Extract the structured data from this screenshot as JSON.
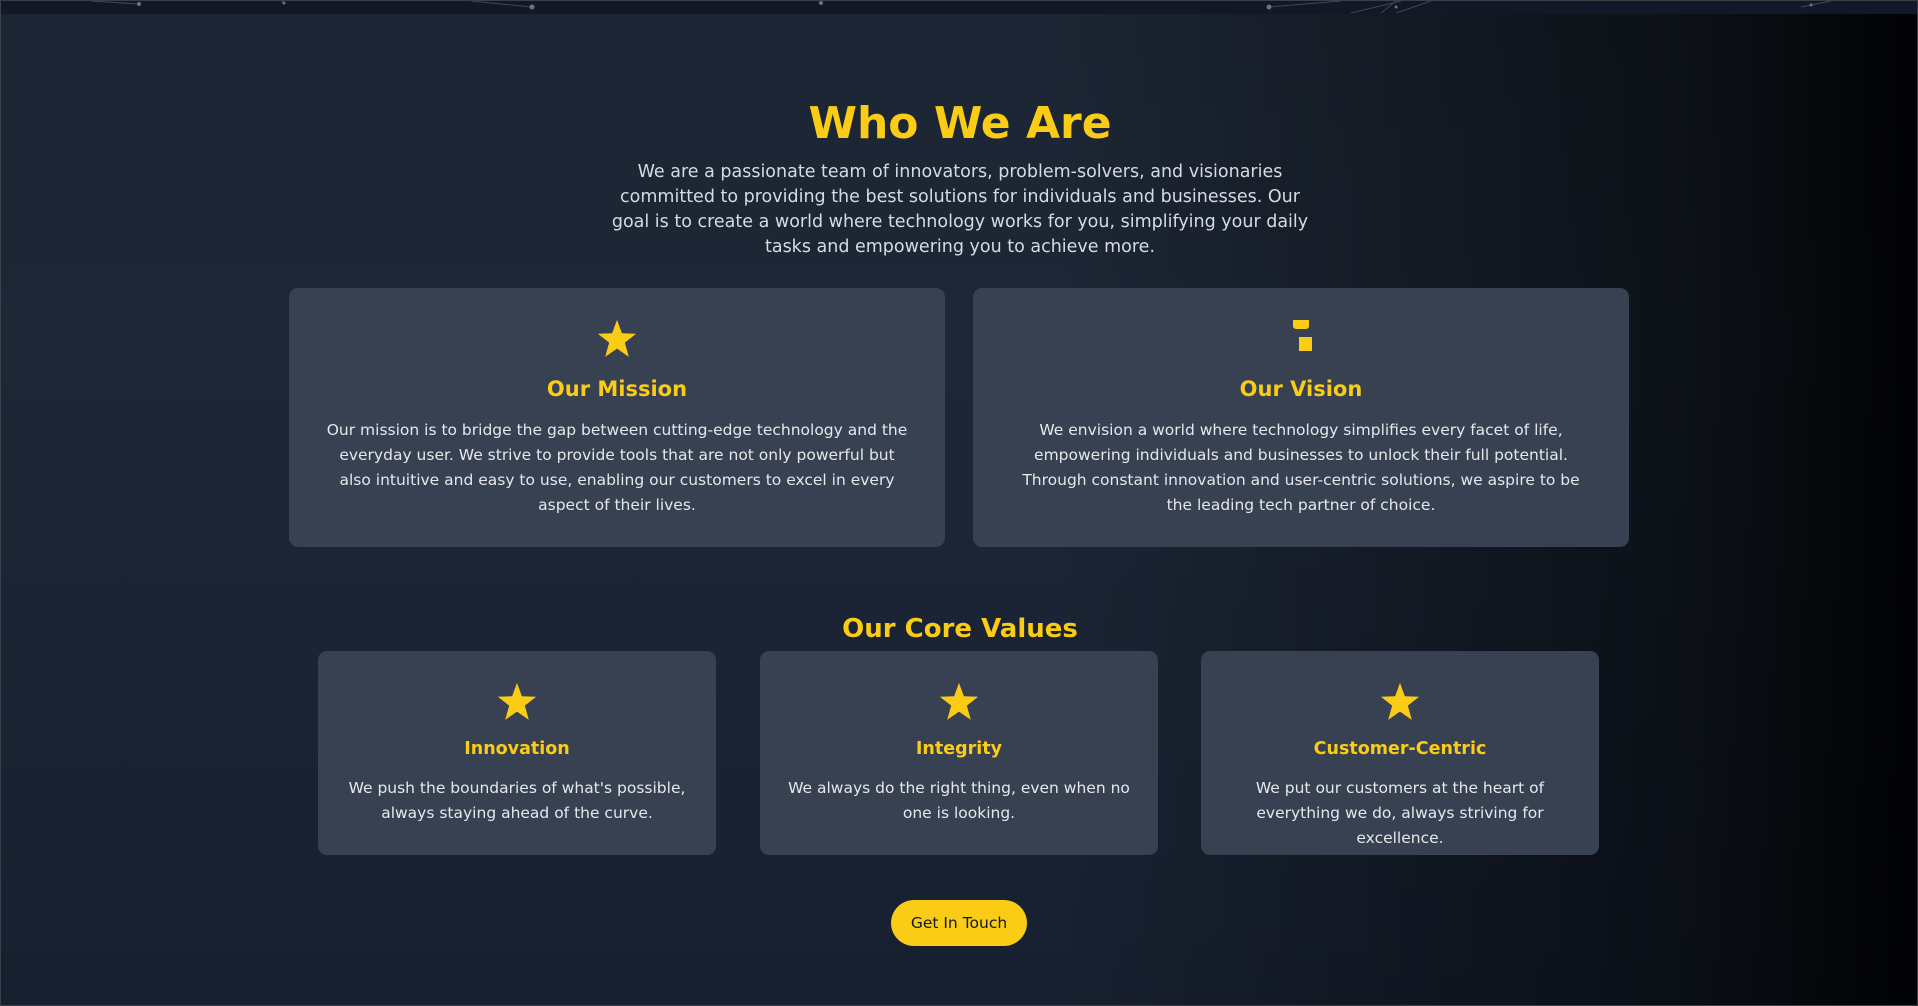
{
  "about": {
    "title": "Who We Are",
    "intro": "We are a passionate team of innovators, problem-solvers, and visionaries committed to providing the best solutions for individuals and businesses. Our goal is to create a world where technology works for you, simplifying your daily tasks and empowering you to achieve more."
  },
  "cards": [
    {
      "icon": "star-icon",
      "title": "Our Mission",
      "text": "Our mission is to bridge the gap between cutting-edge technology and the everyday user. We strive to provide tools that are not only powerful but also intuitive and easy to use, enabling our customers to excel in every aspect of their lives."
    },
    {
      "icon": "lightbulb-icon",
      "title": "Our Vision",
      "text": "We envision a world where technology simplifies every facet of life, empowering individuals and businesses to unlock their full potential. Through constant innovation and user-centric solutions, we aspire to be the leading tech partner of choice."
    }
  ],
  "values": {
    "heading": "Our Core Values",
    "items": [
      {
        "icon": "star-icon",
        "title": "Innovation",
        "text": "We push the boundaries of what's possible, always staying ahead of the curve."
      },
      {
        "icon": "star-icon",
        "title": "Integrity",
        "text": "We always do the right thing, even when no one is looking."
      },
      {
        "icon": "star-icon",
        "title": "Customer-Centric",
        "text": "We put our customers at the heart of everything we do, always striving for excellence."
      }
    ]
  },
  "cta": {
    "label": "Get In Touch"
  },
  "colors": {
    "accent": "#facc15",
    "background": "#1f2937",
    "card": "#374151",
    "text": "#e5e7eb"
  }
}
